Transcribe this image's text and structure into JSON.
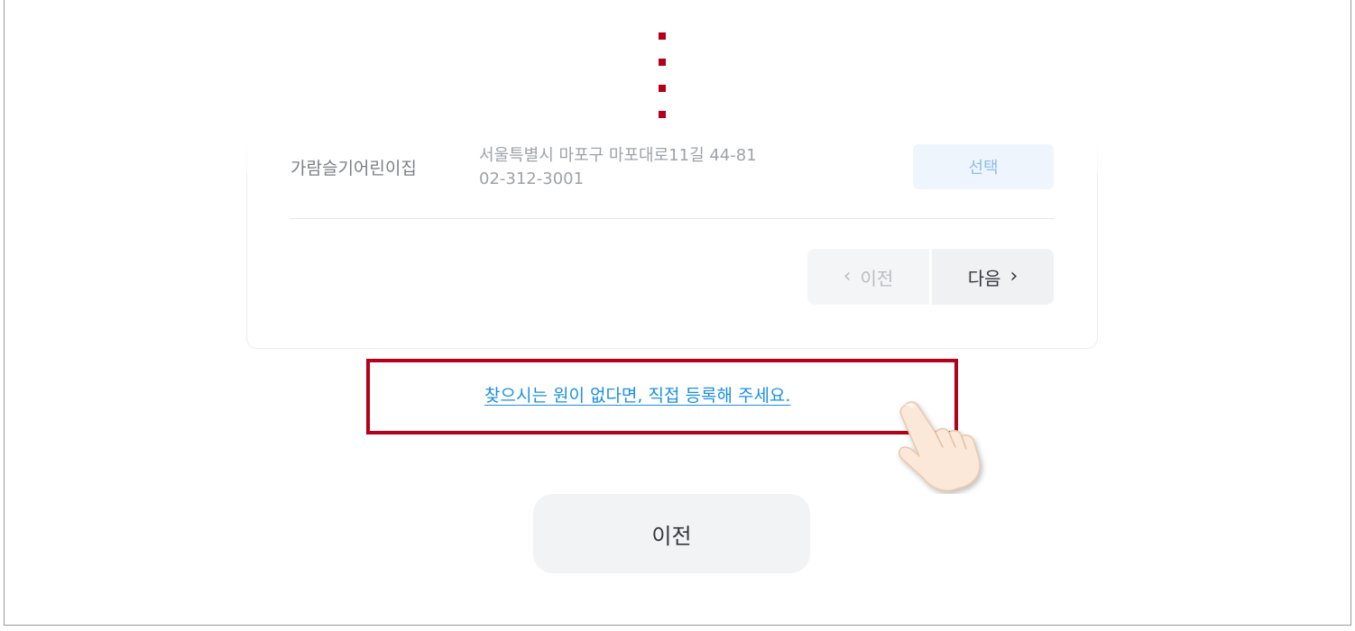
{
  "result_row": {
    "name": "가람슬기어린이집",
    "address": "서울특별시 마포구 마포대로11길 44-81",
    "phone": "02-312-3001",
    "select_label": "선택"
  },
  "pagination": {
    "prev_label": "이전",
    "next_label": "다음",
    "prev_icon": "‹",
    "next_icon": "›"
  },
  "register_link": "찾으시는 원이 없다면, 직접 등록해 주세요.",
  "bottom": {
    "prev_label": "이전"
  },
  "colors": {
    "highlight": "#b4001a",
    "link": "#1a8fe3",
    "select_text": "#8fbde8"
  },
  "icons": {
    "ellipsis": "vertical-ellipsis-icon",
    "hand": "pointing-hand-icon"
  }
}
